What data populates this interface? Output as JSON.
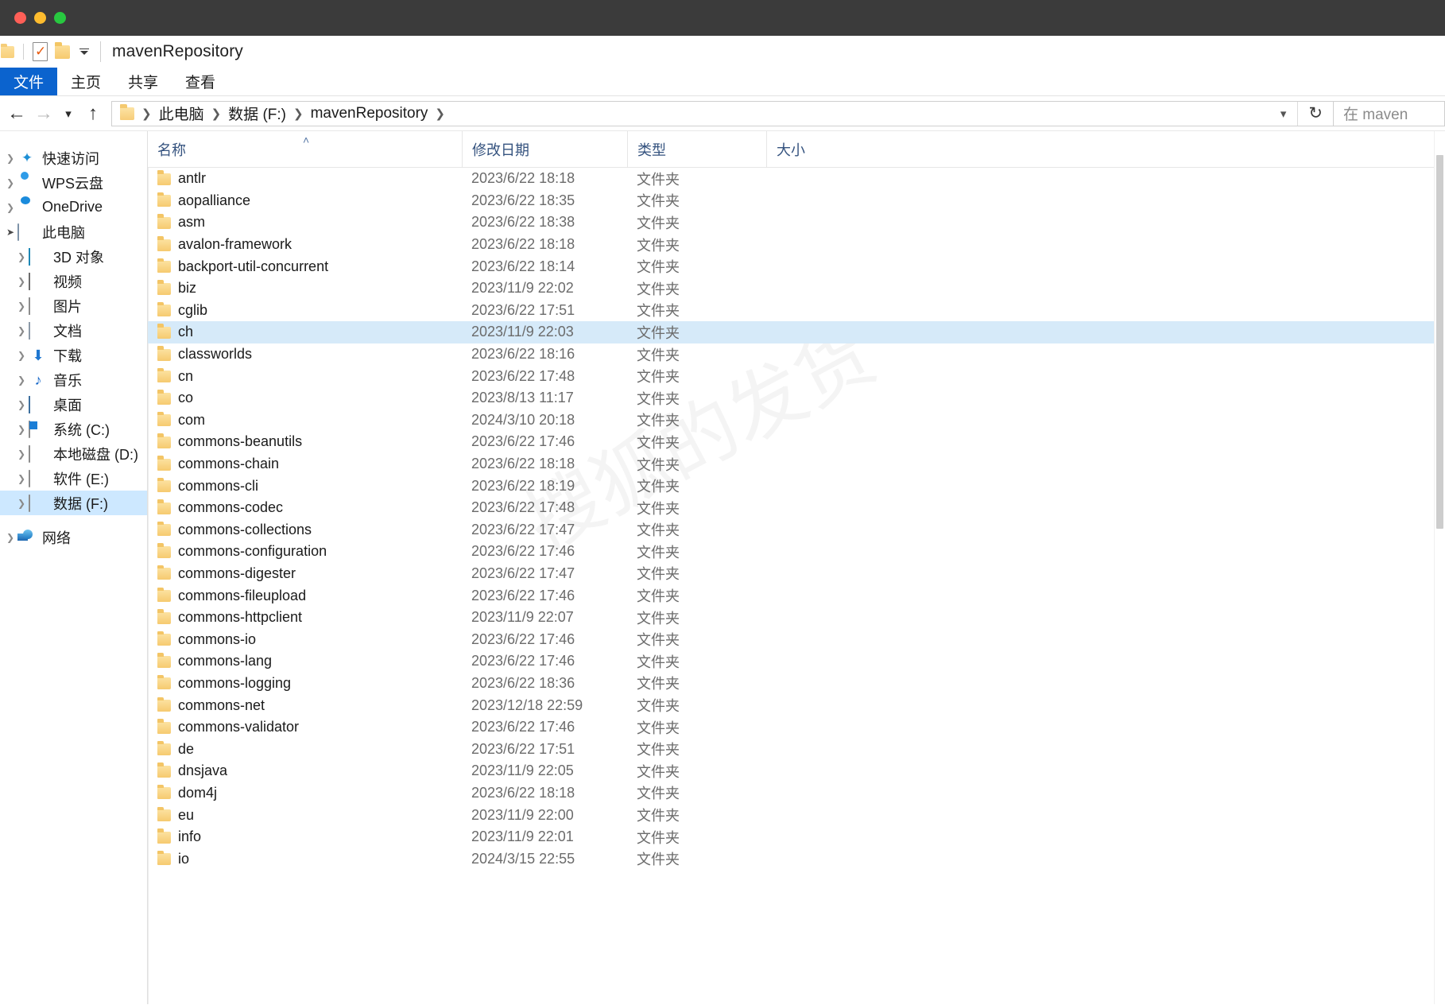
{
  "window": {
    "title": "mavenRepository",
    "traffic_lights": [
      "close-red",
      "minimize-yellow",
      "maximize-green"
    ]
  },
  "quick_access_toolbar": {
    "folder_icon": "folder-icon",
    "properties_icon": "document-check-icon",
    "new_folder_icon": "folder-icon",
    "customize_icon": "chevron-down-icon"
  },
  "ribbon": {
    "tabs": [
      {
        "label": "文件",
        "active": true
      },
      {
        "label": "主页",
        "active": false
      },
      {
        "label": "共享",
        "active": false
      },
      {
        "label": "查看",
        "active": false
      }
    ]
  },
  "nav": {
    "back_icon": "arrow-left-icon",
    "forward_icon": "arrow-right-icon",
    "recent_icon": "chevron-down-icon",
    "up_icon": "arrow-up-icon",
    "breadcrumb": [
      "此电脑",
      "数据 (F:)",
      "mavenRepository"
    ],
    "breadcrumb_separator": "❯",
    "dropdown_icon": "chevron-down-icon",
    "refresh_icon": "refresh-icon"
  },
  "search": {
    "value": "",
    "placeholder": "在 maven"
  },
  "sidebar": {
    "items": [
      {
        "label": "快速访问",
        "icon": "pin-star-icon",
        "chevron": "collapsed",
        "indent": 0,
        "selected": false
      },
      {
        "label": "WPS云盘",
        "icon": "cloud-icon",
        "chevron": "collapsed",
        "indent": 0,
        "selected": false
      },
      {
        "label": "OneDrive",
        "icon": "onedrive-cloud-icon",
        "chevron": "collapsed",
        "indent": 0,
        "selected": false
      },
      {
        "label": "此电脑",
        "icon": "this-pc-icon",
        "chevron": "expanded",
        "indent": 0,
        "selected": false
      },
      {
        "label": "3D 对象",
        "icon": "3d-objects-icon",
        "chevron": "collapsed",
        "indent": 1,
        "selected": false
      },
      {
        "label": "视频",
        "icon": "videos-icon",
        "chevron": "collapsed",
        "indent": 1,
        "selected": false
      },
      {
        "label": "图片",
        "icon": "pictures-icon",
        "chevron": "collapsed",
        "indent": 1,
        "selected": false
      },
      {
        "label": "文档",
        "icon": "documents-icon",
        "chevron": "collapsed",
        "indent": 1,
        "selected": false
      },
      {
        "label": "下载",
        "icon": "downloads-icon",
        "chevron": "collapsed",
        "indent": 1,
        "selected": false
      },
      {
        "label": "音乐",
        "icon": "music-icon",
        "chevron": "collapsed",
        "indent": 1,
        "selected": false
      },
      {
        "label": "桌面",
        "icon": "desktop-icon",
        "chevron": "collapsed",
        "indent": 1,
        "selected": false
      },
      {
        "label": "系统 (C:)",
        "icon": "system-drive-icon",
        "chevron": "collapsed",
        "indent": 1,
        "selected": false
      },
      {
        "label": "本地磁盘 (D:)",
        "icon": "drive-icon",
        "chevron": "collapsed",
        "indent": 1,
        "selected": false
      },
      {
        "label": "软件 (E:)",
        "icon": "drive-icon",
        "chevron": "collapsed",
        "indent": 1,
        "selected": false
      },
      {
        "label": "数据 (F:)",
        "icon": "drive-icon",
        "chevron": "collapsed",
        "indent": 1,
        "selected": true
      },
      {
        "label": "网络",
        "icon": "network-icon",
        "chevron": "collapsed",
        "indent": 0,
        "selected": false
      }
    ]
  },
  "file_list": {
    "columns": [
      {
        "key": "name",
        "label": "名称",
        "sorted": "asc"
      },
      {
        "key": "date",
        "label": "修改日期",
        "sorted": ""
      },
      {
        "key": "type",
        "label": "类型",
        "sorted": ""
      },
      {
        "key": "size",
        "label": "大小",
        "sorted": ""
      }
    ],
    "sort_indicator": "˄",
    "watermark": "搜狐的发货",
    "rows": [
      {
        "name": "antlr",
        "date": "2023/6/22 18:18",
        "type": "文件夹",
        "size": "",
        "selected": false
      },
      {
        "name": "aopalliance",
        "date": "2023/6/22 18:35",
        "type": "文件夹",
        "size": "",
        "selected": false
      },
      {
        "name": "asm",
        "date": "2023/6/22 18:38",
        "type": "文件夹",
        "size": "",
        "selected": false
      },
      {
        "name": "avalon-framework",
        "date": "2023/6/22 18:18",
        "type": "文件夹",
        "size": "",
        "selected": false
      },
      {
        "name": "backport-util-concurrent",
        "date": "2023/6/22 18:14",
        "type": "文件夹",
        "size": "",
        "selected": false
      },
      {
        "name": "biz",
        "date": "2023/11/9 22:02",
        "type": "文件夹",
        "size": "",
        "selected": false
      },
      {
        "name": "cglib",
        "date": "2023/6/22 17:51",
        "type": "文件夹",
        "size": "",
        "selected": false
      },
      {
        "name": "ch",
        "date": "2023/11/9 22:03",
        "type": "文件夹",
        "size": "",
        "selected": true
      },
      {
        "name": "classworlds",
        "date": "2023/6/22 18:16",
        "type": "文件夹",
        "size": "",
        "selected": false
      },
      {
        "name": "cn",
        "date": "2023/6/22 17:48",
        "type": "文件夹",
        "size": "",
        "selected": false
      },
      {
        "name": "co",
        "date": "2023/8/13 11:17",
        "type": "文件夹",
        "size": "",
        "selected": false
      },
      {
        "name": "com",
        "date": "2024/3/10 20:18",
        "type": "文件夹",
        "size": "",
        "selected": false
      },
      {
        "name": "commons-beanutils",
        "date": "2023/6/22 17:46",
        "type": "文件夹",
        "size": "",
        "selected": false
      },
      {
        "name": "commons-chain",
        "date": "2023/6/22 18:18",
        "type": "文件夹",
        "size": "",
        "selected": false
      },
      {
        "name": "commons-cli",
        "date": "2023/6/22 18:19",
        "type": "文件夹",
        "size": "",
        "selected": false
      },
      {
        "name": "commons-codec",
        "date": "2023/6/22 17:48",
        "type": "文件夹",
        "size": "",
        "selected": false
      },
      {
        "name": "commons-collections",
        "date": "2023/6/22 17:47",
        "type": "文件夹",
        "size": "",
        "selected": false
      },
      {
        "name": "commons-configuration",
        "date": "2023/6/22 17:46",
        "type": "文件夹",
        "size": "",
        "selected": false
      },
      {
        "name": "commons-digester",
        "date": "2023/6/22 17:47",
        "type": "文件夹",
        "size": "",
        "selected": false
      },
      {
        "name": "commons-fileupload",
        "date": "2023/6/22 17:46",
        "type": "文件夹",
        "size": "",
        "selected": false
      },
      {
        "name": "commons-httpclient",
        "date": "2023/11/9 22:07",
        "type": "文件夹",
        "size": "",
        "selected": false
      },
      {
        "name": "commons-io",
        "date": "2023/6/22 17:46",
        "type": "文件夹",
        "size": "",
        "selected": false
      },
      {
        "name": "commons-lang",
        "date": "2023/6/22 17:46",
        "type": "文件夹",
        "size": "",
        "selected": false
      },
      {
        "name": "commons-logging",
        "date": "2023/6/22 18:36",
        "type": "文件夹",
        "size": "",
        "selected": false
      },
      {
        "name": "commons-net",
        "date": "2023/12/18 22:59",
        "type": "文件夹",
        "size": "",
        "selected": false
      },
      {
        "name": "commons-validator",
        "date": "2023/6/22 17:46",
        "type": "文件夹",
        "size": "",
        "selected": false
      },
      {
        "name": "de",
        "date": "2023/6/22 17:51",
        "type": "文件夹",
        "size": "",
        "selected": false
      },
      {
        "name": "dnsjava",
        "date": "2023/11/9 22:05",
        "type": "文件夹",
        "size": "",
        "selected": false
      },
      {
        "name": "dom4j",
        "date": "2023/6/22 18:18",
        "type": "文件夹",
        "size": "",
        "selected": false
      },
      {
        "name": "eu",
        "date": "2023/11/9 22:00",
        "type": "文件夹",
        "size": "",
        "selected": false
      },
      {
        "name": "info",
        "date": "2023/11/9 22:01",
        "type": "文件夹",
        "size": "",
        "selected": false
      },
      {
        "name": "io",
        "date": "2024/3/15 22:55",
        "type": "文件夹",
        "size": "",
        "selected": false
      }
    ]
  },
  "colors": {
    "accent": "#0b63ce",
    "selection": "#d6eaf9",
    "sidebar_selection": "#cde8ff",
    "titlebar": "#3b3b3b",
    "header_text": "#35537f",
    "folder_yellow": "#f6ca6f"
  }
}
